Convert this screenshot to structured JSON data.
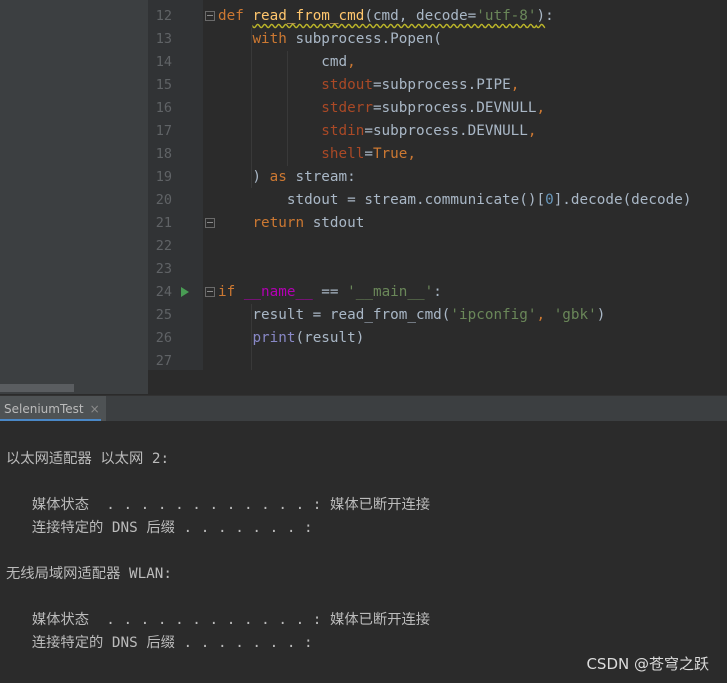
{
  "editor": {
    "line_numbers": [
      "12",
      "13",
      "14",
      "15",
      "16",
      "17",
      "18",
      "19",
      "20",
      "21",
      "22",
      "23",
      "24",
      "25",
      "26",
      "27"
    ]
  },
  "run_panel": {
    "tab_label": "SeleniumTest",
    "tab_close": "×",
    "output": [
      "以太网适配器 以太网 2:",
      "",
      "   媒体状态  . . . . . . . . . . . . : 媒体已断开连接",
      "   连接特定的 DNS 后缀 . . . . . . . :",
      "",
      "无线局域网适配器 WLAN:",
      "",
      "   媒体状态  . . . . . . . . . . . . : 媒体已断开连接",
      "   连接特定的 DNS 后缀 . . . . . . . :"
    ]
  },
  "watermark": "CSDN @苍穹之跃",
  "icons": {
    "run_gutter": "run-triangle-icon",
    "fold": "fold-marker-icon"
  }
}
